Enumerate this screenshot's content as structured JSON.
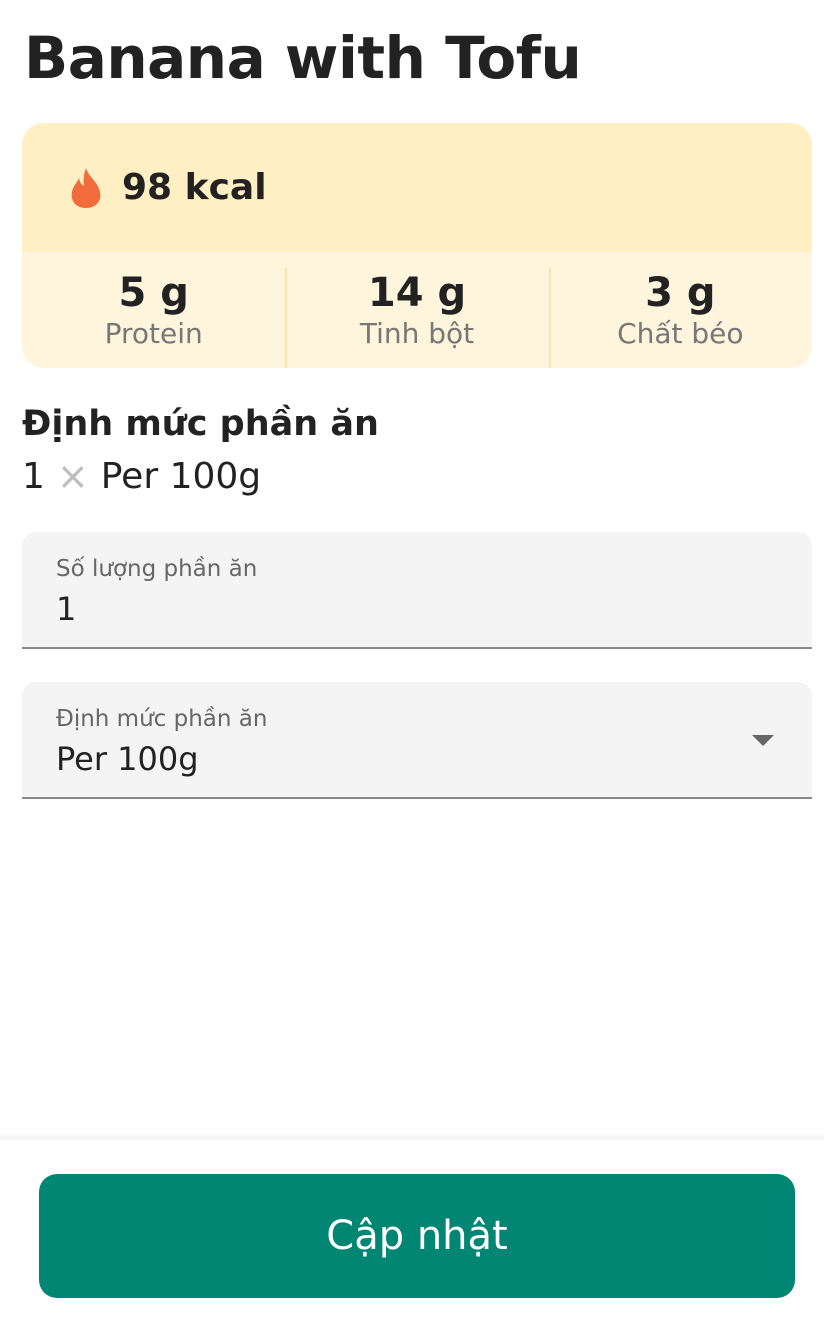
{
  "food": {
    "title": "Banana with Tofu"
  },
  "nutrition": {
    "calories_icon": "flame-icon",
    "calories_text": "98 kcal",
    "macros": [
      {
        "value": "5 g",
        "label": "Protein"
      },
      {
        "value": "14 g",
        "label": "Tinh bột"
      },
      {
        "value": "3 g",
        "label": "Chất béo"
      }
    ]
  },
  "serving": {
    "heading": "Định mức phần ăn",
    "quantity": "1",
    "times_icon": "×",
    "unit": "Per 100g"
  },
  "fields": {
    "quantity": {
      "label": "Số lượng phần ăn",
      "value": "1"
    },
    "unit": {
      "label": "Định mức phần ăn",
      "value": "Per 100g"
    }
  },
  "actions": {
    "update_label": "Cập nhật"
  },
  "colors": {
    "accent": "#008673",
    "flame": "#f26b3a",
    "card_top": "#ffefc2",
    "card_bottom": "#fff5dc"
  }
}
